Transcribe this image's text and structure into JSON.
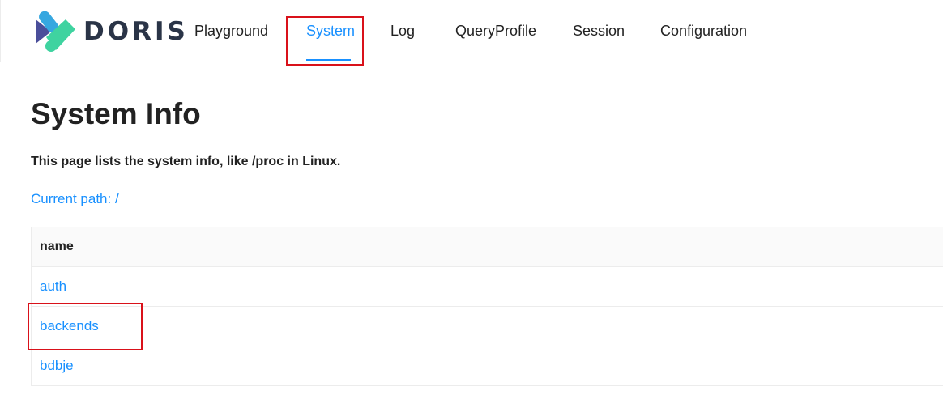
{
  "header": {
    "logo_text": "DORIS",
    "nav": [
      {
        "label": "Playground"
      },
      {
        "label": "System"
      },
      {
        "label": "Log"
      },
      {
        "label": "QueryProfile"
      },
      {
        "label": "Session"
      },
      {
        "label": "Configuration"
      }
    ],
    "active_tab": "System"
  },
  "main": {
    "title": "System Info",
    "description": "This page lists the system info, like /proc in Linux.",
    "current_path": "Current path: /",
    "table": {
      "column_header": "name",
      "rows": [
        "auth",
        "backends",
        "bdbje"
      ]
    }
  },
  "colors": {
    "accent": "#1890ff",
    "highlight_box": "#d9111a",
    "logo_blue": "#2f6fd6",
    "logo_green": "#3fd3a0"
  }
}
